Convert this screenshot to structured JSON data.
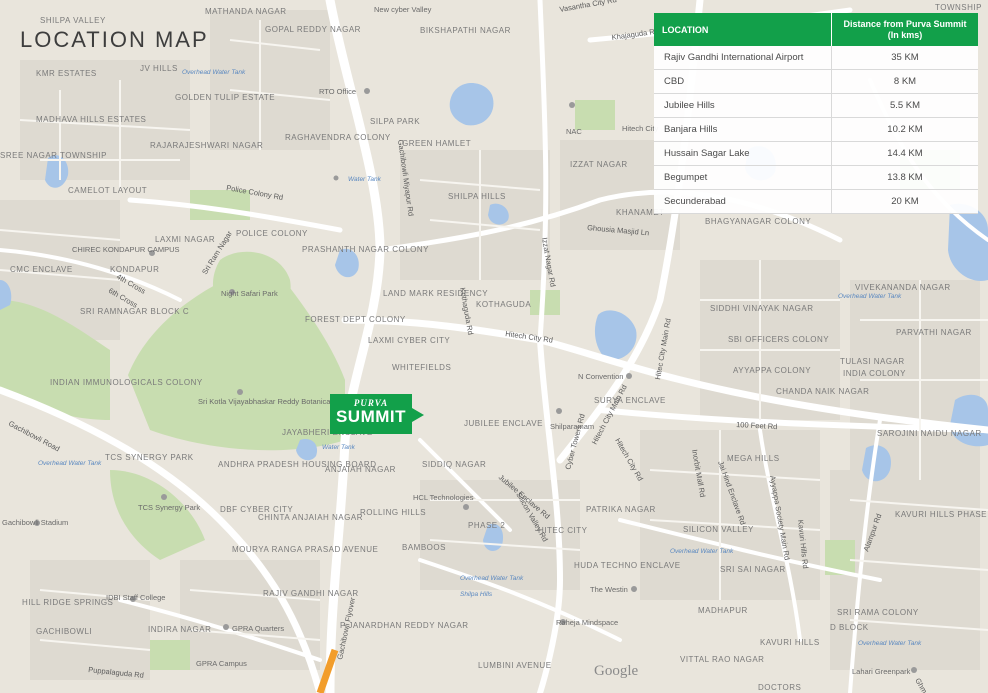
{
  "title": "LOCATION MAP",
  "table": {
    "headers": {
      "location": "LOCATION",
      "distance": "Distance from Purva Summit (In kms)"
    },
    "rows": [
      {
        "location": "Rajiv Gandhi International Airport",
        "distance": "35 KM"
      },
      {
        "location": "CBD",
        "distance": "8 KM"
      },
      {
        "location": "Jubilee Hills",
        "distance": "5.5 KM"
      },
      {
        "location": "Banjara Hills",
        "distance": "10.2 KM"
      },
      {
        "location": "Hussain Sagar Lake",
        "distance": "14.4 KM"
      },
      {
        "location": "Begumpet",
        "distance": "13.8 KM"
      },
      {
        "location": "Secunderabad",
        "distance": "20 KM"
      }
    ]
  },
  "marker": {
    "line1": "PURVA",
    "line2": "SUMMIT"
  },
  "google": "Google",
  "colors": {
    "brand_green": "#12a04a",
    "land": "#e9e5dc",
    "park": "#c8ddb0",
    "water": "#a7c5e8",
    "road": "#ffffff",
    "highlight_road": "#f29d2b"
  },
  "areas": [
    {
      "id": "silpa-valley",
      "text": "SHILPA VALLEY"
    },
    {
      "id": "mathapur",
      "text": "MATHANDA NAGAR"
    },
    {
      "id": "gopal-reddy",
      "text": "GOPAL REDDY NAGAR"
    },
    {
      "id": "kmr-estates",
      "text": "KMR ESTATES"
    },
    {
      "id": "jv-hills",
      "text": "JV HILLS"
    },
    {
      "id": "golden-tulip",
      "text": "GOLDEN TULIP ESTATE"
    },
    {
      "id": "madhava-hills",
      "text": "MADHAVA HILLS ESTATES"
    },
    {
      "id": "rajarajeshwari",
      "text": "RAJARAJESHWARI NAGAR"
    },
    {
      "id": "raghavendra",
      "text": "RAGHAVENDRA COLONY"
    },
    {
      "id": "silpa-park",
      "text": "SILPA PARK"
    },
    {
      "id": "green-hamlet",
      "text": "GREEN HAMLET"
    },
    {
      "id": "shilpa-hills",
      "text": "SHILPA HILLS"
    },
    {
      "id": "camelot",
      "text": "CAMELOT LAYOUT"
    },
    {
      "id": "police-colony",
      "text": "POLICE COLONY"
    },
    {
      "id": "prashanth-nagar",
      "text": "PRASHANTH NAGAR COLONY"
    },
    {
      "id": "laxmi-nagar",
      "text": "LAXMI NAGAR"
    },
    {
      "id": "kondapur",
      "text": "KONDAPUR"
    },
    {
      "id": "cmc-enclave",
      "text": "CMC ENCLAVE"
    },
    {
      "id": "sri-ramnagar",
      "text": "SRI RAMNAGAR BLOCK C"
    },
    {
      "id": "land-mark",
      "text": "LAND MARK RESIDENCY"
    },
    {
      "id": "kothaguda",
      "text": "KOTHAGUDA"
    },
    {
      "id": "forest-dept",
      "text": "FOREST DEPT COLONY"
    },
    {
      "id": "laxmi-cyber",
      "text": "LAXMI CYBER CITY"
    },
    {
      "id": "whitefields",
      "text": "WHITEFIELDS"
    },
    {
      "id": "indian-immuno",
      "text": "INDIAN IMMUNOLOGICALS COLONY"
    },
    {
      "id": "jayabheri",
      "text": "JAYABHERI ENCLAVE"
    },
    {
      "id": "tcs-synergy",
      "text": "TCS SYNERGY PARK"
    },
    {
      "id": "andhra-pradesh",
      "text": "ANDHRA PRADESH HOUSING BOARD"
    },
    {
      "id": "anjaiah",
      "text": "ANJAIAH NAGAR"
    },
    {
      "id": "dbf-cyber",
      "text": "DBF CYBER CITY"
    },
    {
      "id": "chinta-anjaiah",
      "text": "CHINTA ANJAIAH NAGAR"
    },
    {
      "id": "rolling-hills",
      "text": "ROLLING HILLS"
    },
    {
      "id": "bamboos",
      "text": "BAMBOOS"
    },
    {
      "id": "mourya",
      "text": "MOURYA RANGA PRASAD AVENUE"
    },
    {
      "id": "rajiv-gandhi-nagar",
      "text": "RAJIV GANDHI NAGAR"
    },
    {
      "id": "p-janardhan",
      "text": "P JANARDHAN REDDY NAGAR"
    },
    {
      "id": "hill-ridge",
      "text": "HILL RIDGE SPRINGS"
    },
    {
      "id": "gachibowli",
      "text": "GACHIBOWLI"
    },
    {
      "id": "indira-nagar",
      "text": "INDIRA NAGAR"
    },
    {
      "id": "lumbini",
      "text": "LUMBINI AVENUE"
    },
    {
      "id": "jubilee-enclave",
      "text": "JUBILEE ENCLAVE"
    },
    {
      "id": "siddiq-nagar",
      "text": "SIDDIQ NAGAR"
    },
    {
      "id": "patrika-nagar",
      "text": "PATRIKA NAGAR"
    },
    {
      "id": "hitec-city",
      "text": "HITEC CITY"
    },
    {
      "id": "huda-techno",
      "text": "HUDA TECHNO ENCLAVE"
    },
    {
      "id": "phase2",
      "text": "PHASE 2"
    },
    {
      "id": "silicon-valley",
      "text": "SILICON VALLEY"
    },
    {
      "id": "surya-enclave",
      "text": "SURYA ENCLAVE"
    },
    {
      "id": "sri-sai-nagar",
      "text": "SRI SAI NAGAR"
    },
    {
      "id": "madhapur",
      "text": "MADHAPUR"
    },
    {
      "id": "vittal-rao",
      "text": "VITTAL RAO NAGAR"
    },
    {
      "id": "kavuri-hills",
      "text": "KAVURI HILLS"
    },
    {
      "id": "kavuri-phase1",
      "text": "KAVURI HILLS PHASE 1"
    },
    {
      "id": "mega-hills",
      "text": "MEGA HILLS"
    },
    {
      "id": "khanamet",
      "text": "KHANAMET"
    },
    {
      "id": "bhagyanagar",
      "text": "BHAGYANAGAR COLONY"
    },
    {
      "id": "izzat-nagar",
      "text": "IZZAT NAGAR"
    },
    {
      "id": "siddhi-vinayak",
      "text": "SIDDHI VINAYAK NAGAR"
    },
    {
      "id": "sbi-officers",
      "text": "SBI OFFICERS COLONY"
    },
    {
      "id": "ayyappa",
      "text": "AYYAPPA COLONY"
    },
    {
      "id": "chanda-naik",
      "text": "CHANDA NAIK NAGAR"
    },
    {
      "id": "vivekananda",
      "text": "VIVEKANANDA NAGAR"
    },
    {
      "id": "parvathi-nagar",
      "text": "PARVATHI NAGAR"
    },
    {
      "id": "tulasi-nagar",
      "text": "TULASI NAGAR"
    },
    {
      "id": "india-colony",
      "text": "INDIA COLONY"
    },
    {
      "id": "sarojini",
      "text": "SAROJINI NAIDU NAGAR"
    },
    {
      "id": "bikshapathi",
      "text": "BIKSHAPATHI NAGAR"
    },
    {
      "id": "sri-rama",
      "text": "SRI RAMA COLONY"
    },
    {
      "id": "dr-colony",
      "text": "D BLOCK"
    },
    {
      "id": "doctors",
      "text": "DOCTORS"
    },
    {
      "id": "sree-nagar",
      "text": "SREE NAGAR TOWNSHIP"
    },
    {
      "id": "township",
      "text": "TOWNSHIP"
    }
  ],
  "pois": [
    {
      "id": "new-cyber-valley",
      "text": "New cyber Valley"
    },
    {
      "id": "rto-office",
      "text": "RTO Office"
    },
    {
      "id": "nac",
      "text": "NAC"
    },
    {
      "id": "hitech-city-stn",
      "text": "Hitech City"
    },
    {
      "id": "chirec",
      "text": "CHIREC KONDAPUR CAMPUS"
    },
    {
      "id": "night-safari",
      "text": "Night Safari Park"
    },
    {
      "id": "botanical-garden",
      "text": "Sri Kotla Vijayabhaskar Reddy Botanical Garden"
    },
    {
      "id": "n-convention",
      "text": "N Convention"
    },
    {
      "id": "shilparamam",
      "text": "Shilparamam"
    },
    {
      "id": "hcl",
      "text": "HCL Technologies"
    },
    {
      "id": "gachibowli-stadium",
      "text": "Gachibowli Stadium"
    },
    {
      "id": "tcs-synergy-poi",
      "text": "TCS Synergy Park"
    },
    {
      "id": "idbi",
      "text": "IDBI Staff College"
    },
    {
      "id": "gpra-quarters",
      "text": "GPRA Quarters"
    },
    {
      "id": "gpra-campus",
      "text": "GPRA Campus"
    },
    {
      "id": "westin",
      "text": "The Westin"
    },
    {
      "id": "raheja",
      "text": "Raheja Mindspace"
    },
    {
      "id": "lahari",
      "text": "Lahari Greenpark"
    },
    {
      "id": "water-tank-1",
      "text": "Overhead Water Tank"
    },
    {
      "id": "water-tank-2",
      "text": "Water Tank"
    },
    {
      "id": "water-tank-3",
      "text": "Water Tank"
    },
    {
      "id": "water-tank-4",
      "text": "Overhead Water Tank"
    },
    {
      "id": "water-tank-5",
      "text": "Overhead Water Tank"
    },
    {
      "id": "water-tank-6",
      "text": "Overhead Water Tank"
    },
    {
      "id": "water-tank-7",
      "text": "Overhead Water Tank"
    },
    {
      "id": "water-tank-8",
      "text": "Overhead Water Tank"
    },
    {
      "id": "shilpa-hills-tank",
      "text": "Shilpa Hills"
    }
  ],
  "roads": [
    {
      "id": "gachibowli-road",
      "text": "Gachibowli Road"
    },
    {
      "id": "hitech-city-rd-1",
      "text": "Hitech City Rd"
    },
    {
      "id": "hitech-city-rd-2",
      "text": "Hitech City Rd"
    },
    {
      "id": "hitech-city-main",
      "text": "Hitech City Main Rd"
    },
    {
      "id": "100-feet",
      "text": "100 Feet Rd"
    },
    {
      "id": "gachibowli-miyapur",
      "text": "Gachibowli Miyapur Rd"
    },
    {
      "id": "police-colony-rd",
      "text": "Police Colony Rd"
    },
    {
      "id": "ayyappa-society",
      "text": "Ayyappa Society Main Rd"
    },
    {
      "id": "gachibowli-flyover",
      "text": "Gachibowli Flyover"
    },
    {
      "id": "cyber-towers",
      "text": "Cyber Towers Rd"
    },
    {
      "id": "khajaguda",
      "text": "Khajaguda Rd"
    },
    {
      "id": "jubilee-enclave-rd",
      "text": "Jubilee Enclave Rd"
    },
    {
      "id": "sri-ram-nagar-rd",
      "text": "Sri Ram Nagar"
    },
    {
      "id": "6th-cross",
      "text": "6th Cross"
    },
    {
      "id": "4th-cross",
      "text": "4th Cross"
    },
    {
      "id": "alampur",
      "text": "Alampur Rd"
    },
    {
      "id": "khanamet-road",
      "text": "Ghousia Masjid Ln"
    },
    {
      "id": "izzat-rd",
      "text": "Izzat Nagar Rd"
    },
    {
      "id": "vasanta-rd",
      "text": "Vasantha City Rd"
    },
    {
      "id": "inorbit",
      "text": "Inorbit Mall Rd"
    },
    {
      "id": "jain",
      "text": "Jai Hind Enclave Rd"
    },
    {
      "id": "kavuri-rd",
      "text": "Kavuri Hills Rd"
    },
    {
      "id": "kothaguda-rd",
      "text": "Kothaguda Rd"
    },
    {
      "id": "pupalaguda",
      "text": "Puppalaguda Rd"
    },
    {
      "id": "silicon-rd",
      "text": "Silicon Valley Rd"
    },
    {
      "id": "ghm",
      "text": "Ghm Rd"
    },
    {
      "id": "hitec-main",
      "text": "Hitec City Main Rd"
    }
  ]
}
